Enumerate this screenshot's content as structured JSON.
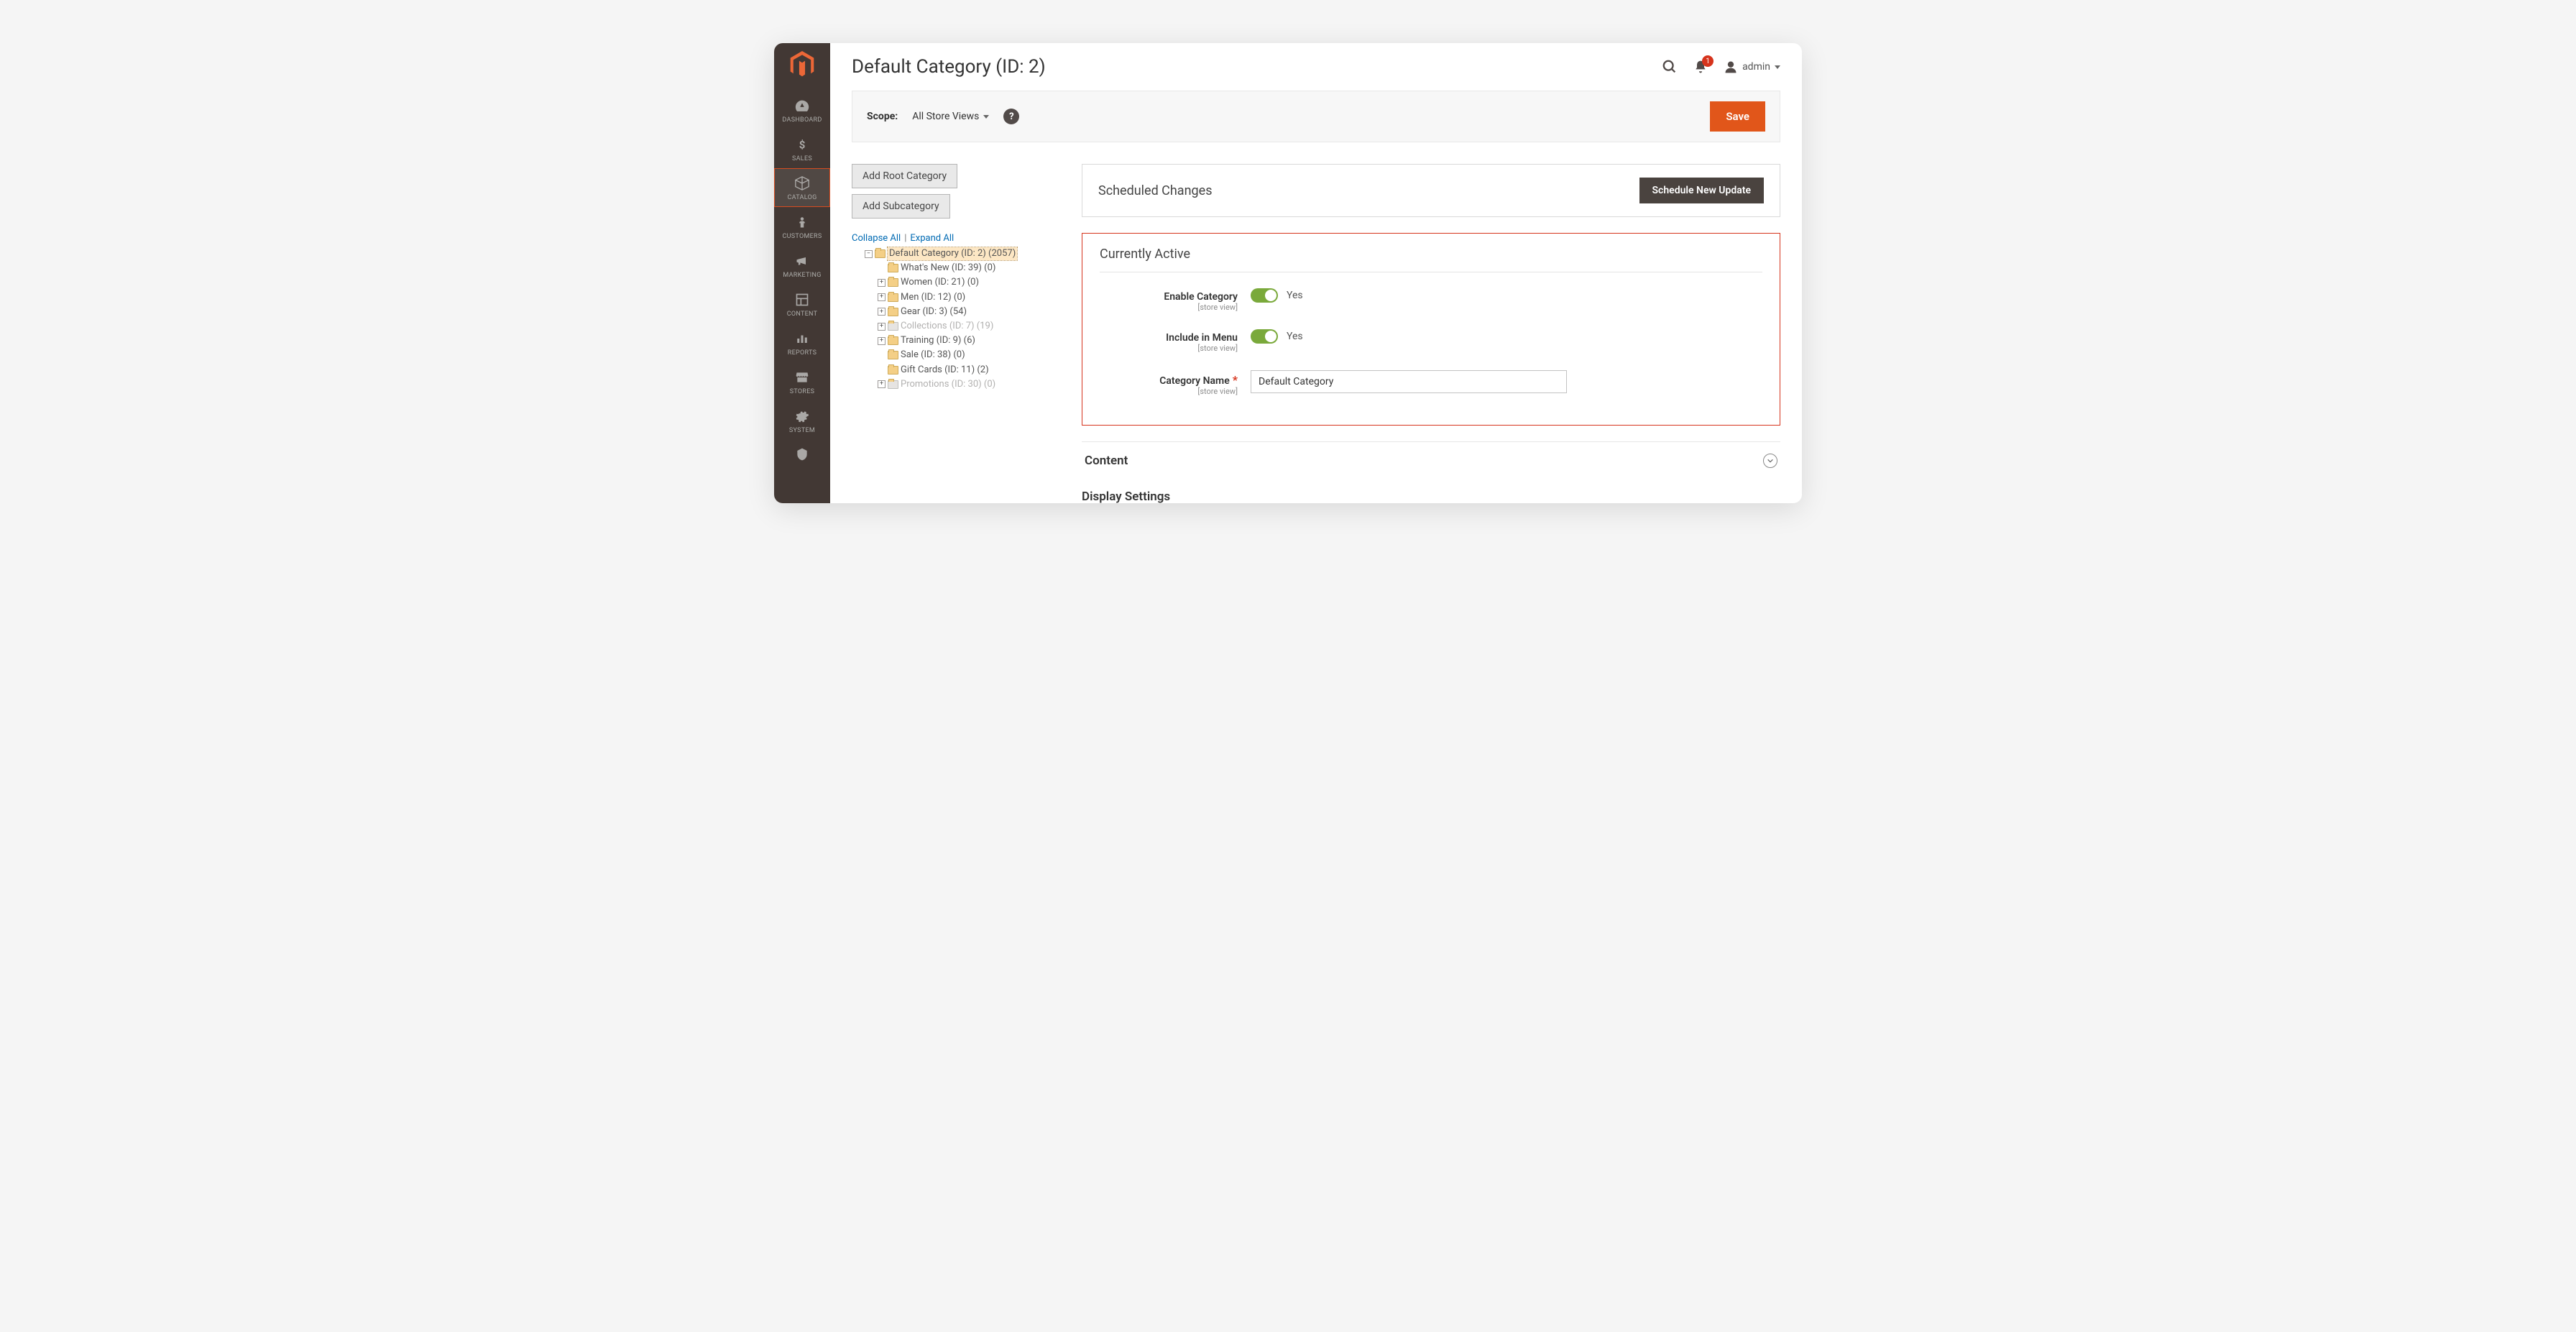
{
  "sidebar": {
    "items": [
      {
        "label": "DASHBOARD"
      },
      {
        "label": "SALES"
      },
      {
        "label": "CATALOG"
      },
      {
        "label": "CUSTOMERS"
      },
      {
        "label": "MARKETING"
      },
      {
        "label": "CONTENT"
      },
      {
        "label": "REPORTS"
      },
      {
        "label": "STORES"
      },
      {
        "label": "SYSTEM"
      },
      {
        "label": "FIND PARTNERS"
      }
    ]
  },
  "header": {
    "title": "Default Category (ID: 2)",
    "notif_count": "1",
    "user_name": "admin"
  },
  "scope": {
    "label": "Scope:",
    "value": "All Store Views",
    "save_label": "Save"
  },
  "tree_btns": {
    "add_root": "Add Root Category",
    "add_sub": "Add Subcategory"
  },
  "tree_links": {
    "collapse": "Collapse All",
    "expand": "Expand All"
  },
  "tree": {
    "root": "Default Category (ID: 2) (2057)",
    "children": [
      {
        "label": "What's New (ID: 39) (0)",
        "toggle": ""
      },
      {
        "label": "Women (ID: 21) (0)",
        "toggle": "+"
      },
      {
        "label": "Men (ID: 12) (0)",
        "toggle": "+"
      },
      {
        "label": "Gear (ID: 3) (54)",
        "toggle": "+"
      },
      {
        "label": "Collections (ID: 7) (19)",
        "toggle": "+",
        "disabled": true
      },
      {
        "label": "Training (ID: 9) (6)",
        "toggle": "+"
      },
      {
        "label": "Sale (ID: 38) (0)",
        "toggle": ""
      },
      {
        "label": "Gift Cards (ID: 11) (2)",
        "toggle": ""
      },
      {
        "label": "Promotions (ID: 30) (0)",
        "toggle": "+",
        "disabled": true
      }
    ]
  },
  "scheduled": {
    "title": "Scheduled Changes",
    "btn": "Schedule New Update"
  },
  "active_section": {
    "title": "Currently Active",
    "enable_label": "Enable Category",
    "enable_sub": "[store view]",
    "enable_state": "Yes",
    "include_label": "Include in Menu",
    "include_sub": "[store view]",
    "include_state": "Yes",
    "name_label": "Category Name",
    "name_sub": "[store view]",
    "name_value": "Default Category"
  },
  "collapse": {
    "content": "Content",
    "display": "Display Settings"
  }
}
